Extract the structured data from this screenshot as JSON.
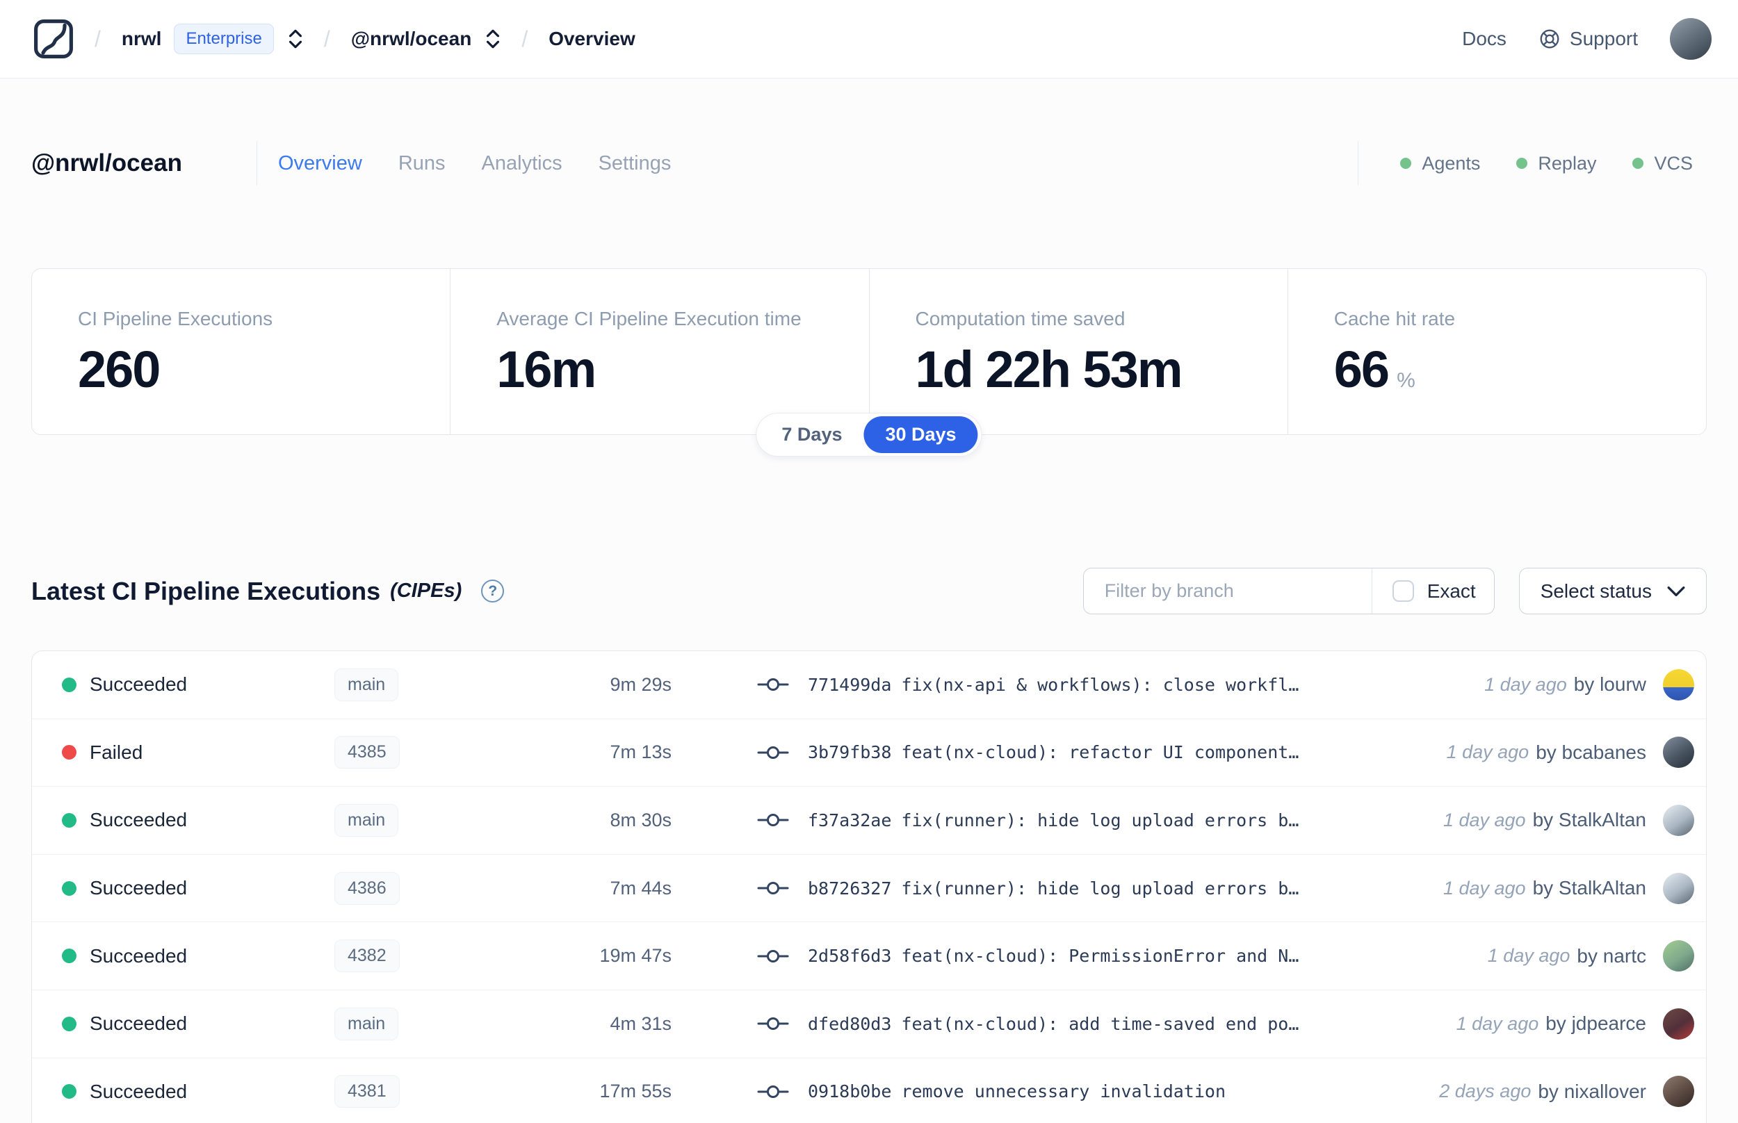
{
  "colors": {
    "accent_blue": "#2e62e6",
    "tab_active_blue": "#3b7af0",
    "success_green": "#22bb87",
    "failed_red": "#ef4a4a",
    "integration_green": "#74c28c"
  },
  "navbar": {
    "logo_icon": "nx-cloud-logo",
    "breadcrumb": {
      "separator": "/",
      "org": "nrwl",
      "org_badge": "Enterprise",
      "workspace": "@nrwl/ocean",
      "page": "Overview"
    },
    "docs_label": "Docs",
    "support_label": "Support"
  },
  "header": {
    "title": "@nrwl/ocean",
    "tabs": [
      {
        "label": "Overview",
        "active": true
      },
      {
        "label": "Runs",
        "active": false
      },
      {
        "label": "Analytics",
        "active": false
      },
      {
        "label": "Settings",
        "active": false
      }
    ],
    "integrations": [
      {
        "label": "Agents"
      },
      {
        "label": "Replay"
      },
      {
        "label": "VCS"
      }
    ]
  },
  "stats": {
    "cards": [
      {
        "label": "CI Pipeline Executions",
        "value": "260",
        "suffix": ""
      },
      {
        "label": "Average CI Pipeline Execution time",
        "value": "16m",
        "suffix": ""
      },
      {
        "label": "Computation time saved",
        "value": "1d 22h 53m",
        "suffix": ""
      },
      {
        "label": "Cache hit rate",
        "value": "66",
        "suffix": "%"
      }
    ],
    "range_toggle": {
      "options": [
        {
          "label": "7 Days",
          "selected": false
        },
        {
          "label": "30 Days",
          "selected": true
        }
      ]
    }
  },
  "cipe": {
    "title": "Latest CI Pipeline Executions",
    "title_annotation": "(CIPEs)",
    "help_glyph": "?",
    "filter": {
      "placeholder": "Filter by branch",
      "exact_label": "Exact"
    },
    "status_select_label": "Select status",
    "rows": [
      {
        "status": "Succeeded",
        "status_color": "green",
        "branch": "main",
        "duration": "9m 29s",
        "commit_hash": "771499da",
        "commit_message": "fix(nx-api & workflows): close workfl…",
        "time_ago": "1 day ago",
        "author": "by lourw",
        "avatar_id": "lourw"
      },
      {
        "status": "Failed",
        "status_color": "red",
        "branch": "4385",
        "duration": "7m 13s",
        "commit_hash": "3b79fb38",
        "commit_message": "feat(nx-cloud): refactor UI component…",
        "time_ago": "1 day ago",
        "author": "by bcabanes",
        "avatar_id": "bcabanes"
      },
      {
        "status": "Succeeded",
        "status_color": "green",
        "branch": "main",
        "duration": "8m 30s",
        "commit_hash": "f37a32ae",
        "commit_message": "fix(runner): hide log upload errors b…",
        "time_ago": "1 day ago",
        "author": "by StalkAltan",
        "avatar_id": "stalkaltan"
      },
      {
        "status": "Succeeded",
        "status_color": "green",
        "branch": "4386",
        "duration": "7m 44s",
        "commit_hash": "b8726327",
        "commit_message": "fix(runner): hide log upload errors b…",
        "time_ago": "1 day ago",
        "author": "by StalkAltan",
        "avatar_id": "stalkaltan"
      },
      {
        "status": "Succeeded",
        "status_color": "green",
        "branch": "4382",
        "duration": "19m 47s",
        "commit_hash": "2d58f6d3",
        "commit_message": "feat(nx-cloud): PermissionError and N…",
        "time_ago": "1 day ago",
        "author": "by nartc",
        "avatar_id": "nartc"
      },
      {
        "status": "Succeeded",
        "status_color": "green",
        "branch": "main",
        "duration": "4m 31s",
        "commit_hash": "dfed80d3",
        "commit_message": "feat(nx-cloud): add time-saved end po…",
        "time_ago": "1 day ago",
        "author": "by jdpearce",
        "avatar_id": "jdpearce"
      },
      {
        "status": "Succeeded",
        "status_color": "green",
        "branch": "4381",
        "duration": "17m 55s",
        "commit_hash": "0918b0be",
        "commit_message": "remove unnecessary invalidation",
        "time_ago": "2 days ago",
        "author": "by nixallover",
        "avatar_id": "nixallover"
      }
    ]
  }
}
